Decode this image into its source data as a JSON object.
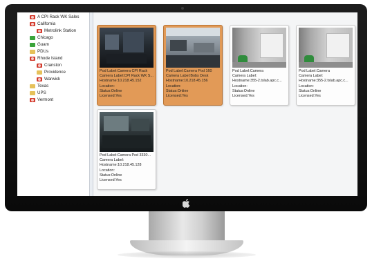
{
  "tree": {
    "items": [
      {
        "label": "A CPI Rack WK Sales",
        "indent": 1,
        "icon": "red"
      },
      {
        "label": "California",
        "indent": 1,
        "icon": "red"
      },
      {
        "label": "Metrolink Station",
        "indent": 2,
        "icon": "red"
      },
      {
        "label": "Chicago",
        "indent": 1,
        "icon": "green"
      },
      {
        "label": "Guam",
        "indent": 1,
        "icon": "green"
      },
      {
        "label": "PDUs",
        "indent": 1,
        "icon": "folder"
      },
      {
        "label": "Rhode Island",
        "indent": 1,
        "icon": "red"
      },
      {
        "label": "Cranston",
        "indent": 2,
        "icon": "red"
      },
      {
        "label": "Providence",
        "indent": 2,
        "icon": "folder"
      },
      {
        "label": "Warwick",
        "indent": 2,
        "icon": "red"
      },
      {
        "label": "Texas",
        "indent": 1,
        "icon": "folder"
      },
      {
        "label": "UPS",
        "indent": 1,
        "icon": "folder"
      },
      {
        "label": "Vermont",
        "indent": 1,
        "icon": "red"
      }
    ]
  },
  "cameras": [
    {
      "selected": true,
      "scene": "dark",
      "lines": [
        "Pod Label:Camera CPI Rack",
        "Camera Label:CPI Rack WK S...",
        "Hostname:10.218.45.152",
        "Location:",
        "Status:Online",
        "Licensed:Yes"
      ]
    },
    {
      "selected": true,
      "scene": "office",
      "lines": [
        "Pod Label:Camera Pod 160",
        "Camera Label:Bobs Desk",
        "Hostname:10.218.45.156",
        "Location:",
        "Status:Online",
        "Licensed:Yes"
      ]
    },
    {
      "selected": false,
      "scene": "wall",
      "lines": [
        "Pod Label:Camera",
        "Camera Label:",
        "Hostname:355-2.tslab.apc.c...",
        "Location:",
        "Status:Online",
        "Licensed:Yes"
      ]
    },
    {
      "selected": false,
      "scene": "wall",
      "lines": [
        "Pod Label:Camera",
        "Camera Label:",
        "Hostname:355-2.tslab.apc.c...",
        "Location:",
        "Status:Online",
        "Licensed:Yes"
      ]
    },
    {
      "selected": false,
      "scene": "lab",
      "lines": [
        "Pod Label:Camera Pod 3330...",
        "Camera Label:",
        "Hostname:10.218.45.128",
        "Location:",
        "Status:Online",
        "Licensed:Yes"
      ]
    }
  ],
  "colors": {
    "selected_tile": "#e29a57",
    "status_alarm": "#d33a2c",
    "status_ok": "#3aa33a",
    "folder": "#e6c15a"
  },
  "icons": {
    "brand": "apple-logo-icon",
    "alarm": "alarm-status-icon",
    "ok": "ok-status-icon",
    "folder": "folder-icon"
  },
  "logo_glyph": ""
}
